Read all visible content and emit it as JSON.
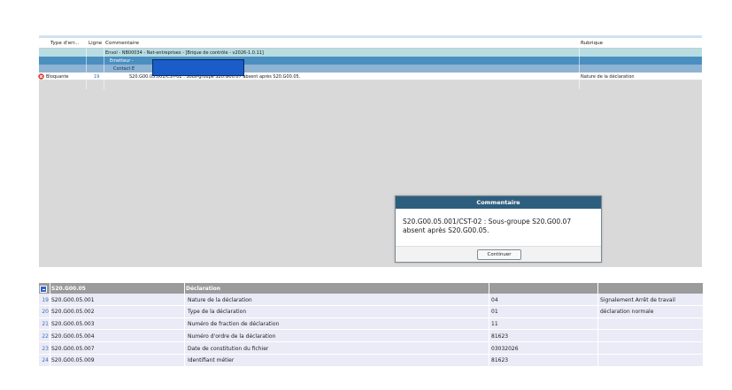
{
  "error_grid": {
    "columns": {
      "type_erreur": "Type d'err...",
      "ligne": "Ligne",
      "commentaire": "Commentaire",
      "rubrique": "Rubrique"
    },
    "envoi_label": "Envol - NB00034 - Net-entreprises - [Brique de contrôle - v2026-1.0.11]",
    "emetteur_label": "Emetteur -",
    "contact_label": "Contact E",
    "rows": [
      {
        "type": "Bloquante",
        "ligne": "19",
        "commentaire": "S20.G00.05.001/CST-02 : Sous-groupe S20.G00.07 absent après S20.G00.05.",
        "rubrique": "Nature de la déclaration"
      }
    ]
  },
  "dialog": {
    "title": "Commentaire",
    "message": "S20.G00.05.001/CST-02 : Sous-groupe S20.G00.07 absent après S20.G00.05.",
    "button": "Continuer"
  },
  "detail_table": {
    "group_code": "S20.G00.05",
    "group_label": "Déclaration",
    "rows": [
      {
        "num": "19",
        "code": "S20.G00.05.001",
        "label": "Nature de la déclaration",
        "value": "04",
        "description": "Signalement Arrêt de travail"
      },
      {
        "num": "20",
        "code": "S20.G00.05.002",
        "label": "Type de la déclaration",
        "value": "01",
        "description": "déclaration normale"
      },
      {
        "num": "21",
        "code": "S20.G00.05.003",
        "label": "Numéro de fraction de déclaration",
        "value": "11",
        "description": ""
      },
      {
        "num": "22",
        "code": "S20.G00.05.004",
        "label": "Numéro d'ordre de la déclaration",
        "value": "81623",
        "description": ""
      },
      {
        "num": "23",
        "code": "S20.G00.05.007",
        "label": "Date de constitution du fichier",
        "value": "03032026",
        "description": ""
      },
      {
        "num": "24",
        "code": "S20.G00.05.009",
        "label": "Identifiant métier",
        "value": "81623",
        "description": ""
      }
    ]
  },
  "colors": {
    "envoi_row": "#b7dde3",
    "emetteur_row": "#4a8fc0",
    "contact_row": "#8fb3d3",
    "dialog_header": "#2e5e7e",
    "detail_header": "#9b9b9b",
    "detail_row": "#ebebf7",
    "redaction": "#1a5cc8",
    "error_icon": "#d63a2a"
  },
  "icons": {
    "error": "red-x-error-icon",
    "collapse": "minus-square-icon"
  }
}
